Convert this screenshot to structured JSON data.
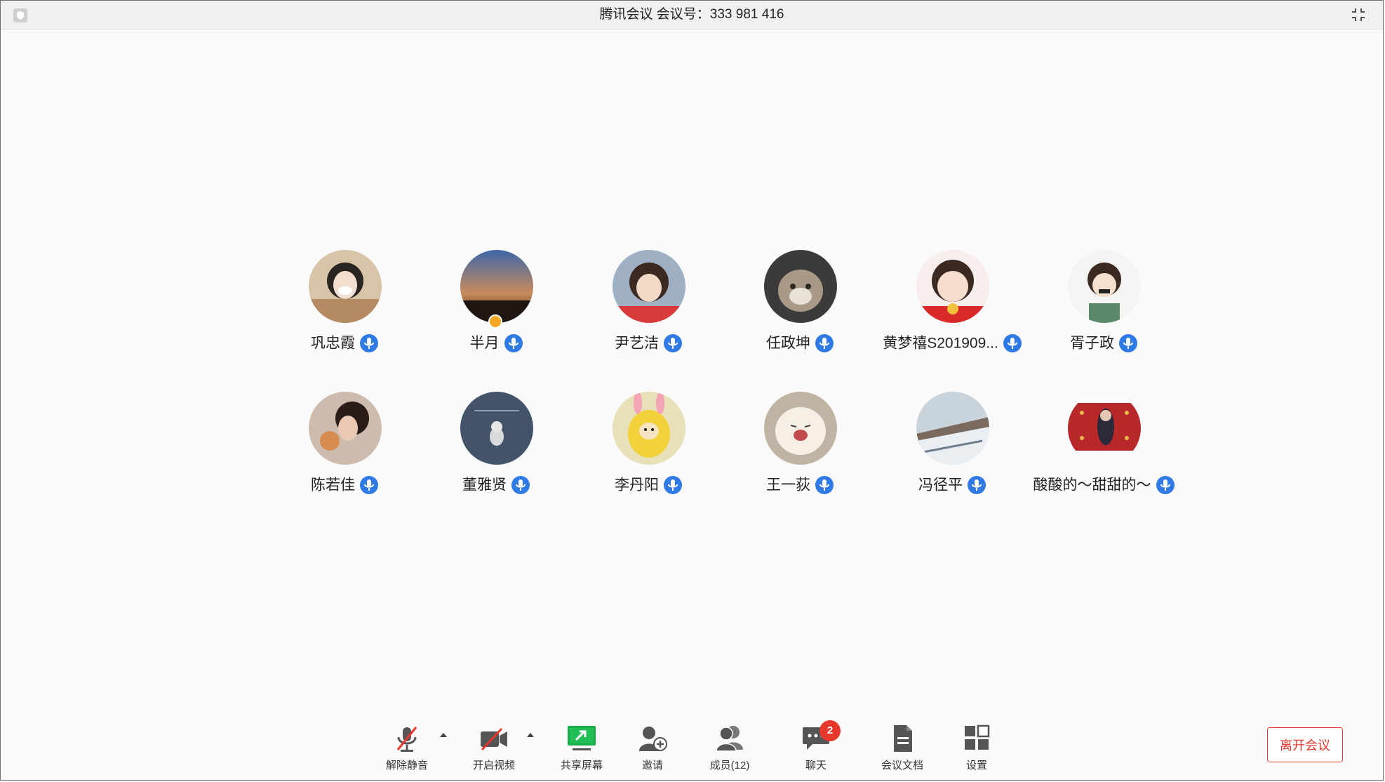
{
  "window": {
    "title": "腾讯会议 会议号：333 981 416"
  },
  "participants": [
    {
      "name": "巩忠霞",
      "mic": "on"
    },
    {
      "name": "半月",
      "mic": "on",
      "host": true
    },
    {
      "name": "尹艺洁",
      "mic": "on"
    },
    {
      "name": "任政坤",
      "mic": "on"
    },
    {
      "name": "黄梦禧S201909...",
      "mic": "on"
    },
    {
      "name": "胥子政",
      "mic": "on"
    },
    {
      "name": "陈若佳",
      "mic": "on"
    },
    {
      "name": "董雅贤",
      "mic": "on"
    },
    {
      "name": "李丹阳",
      "mic": "on"
    },
    {
      "name": "王一荻",
      "mic": "on"
    },
    {
      "name": "冯径平",
      "mic": "on"
    },
    {
      "name": "酸酸的～甜甜的～",
      "mic": "on"
    }
  ],
  "toolbar": {
    "unmute_label": "解除静音",
    "video_label": "开启视频",
    "share_label": "共享屏幕",
    "invite_label": "邀请",
    "members_label": "成员(12)",
    "chat_label": "聊天",
    "chat_badge": "2",
    "docs_label": "会议文档",
    "settings_label": "设置",
    "leave_label": "离开会议"
  },
  "colors": {
    "accent_blue": "#2f7ae5",
    "leave_red": "#e8372c",
    "share_green": "#1aad4b",
    "mute_slash": "#e8372c"
  }
}
